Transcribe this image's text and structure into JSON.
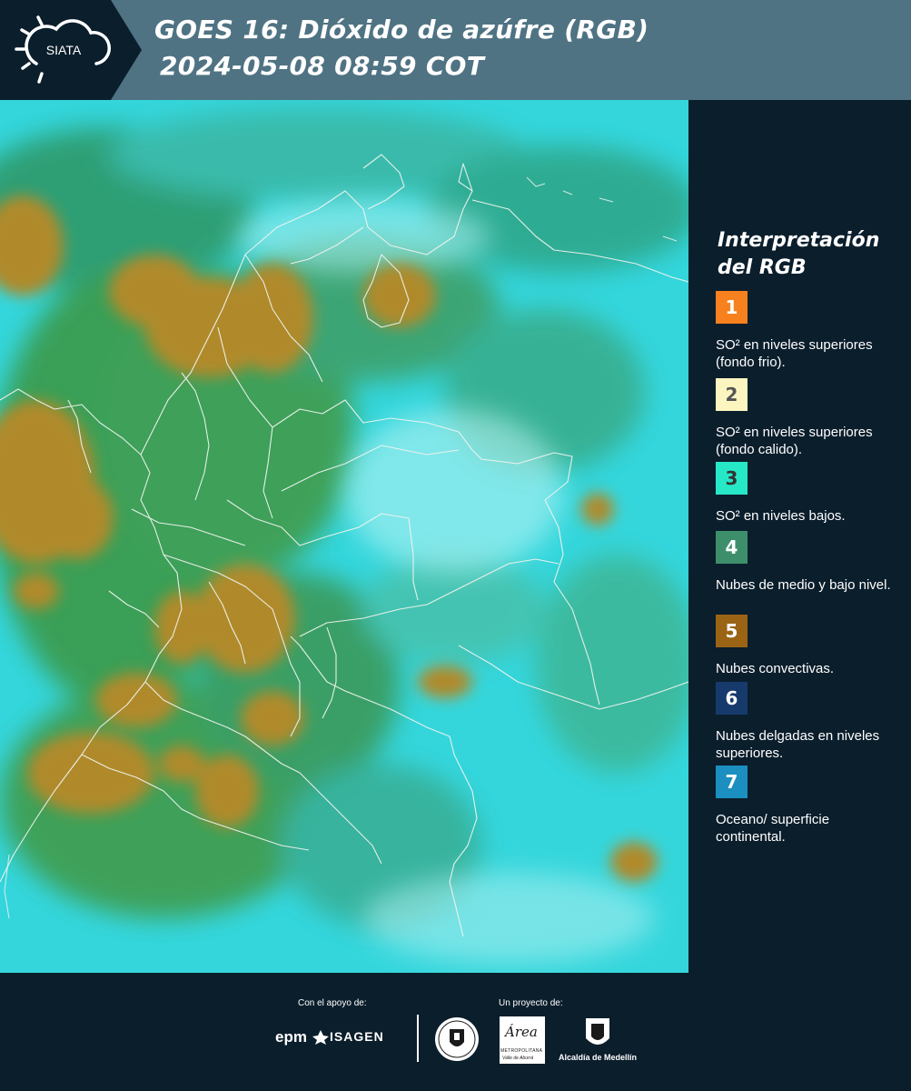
{
  "header": {
    "logo_text": "SIATA",
    "title_line1": "GOES 16: Dióxido de azúfre (RGB)",
    "title_line2": "2024-05-08 08:59 COT"
  },
  "legend": {
    "title": "Interpretación del RGB",
    "items": [
      {
        "number": "1",
        "label": "SO² en niveles superiores (fondo frio).",
        "color": "#f7811e",
        "text_color": "#ffffff"
      },
      {
        "number": "2",
        "label": "SO² en niveles superiores (fondo calido).",
        "color": "#fdf5c0",
        "text_color": "#555555"
      },
      {
        "number": "3",
        "label": "SO² en niveles bajos.",
        "color": "#27e8c6",
        "text_color": "#333333"
      },
      {
        "number": "4",
        "label": "Nubes de medio y bajo nivel.",
        "color": "#3d8f6b",
        "text_color": "#ffffff"
      },
      {
        "number": "5",
        "label": "Nubes convectivas.",
        "color": "#9a6414",
        "text_color": "#ffffff"
      },
      {
        "number": "6",
        "label": "Nubes delgadas en niveles superiores.",
        "color": "#173a6d",
        "text_color": "#ffffff"
      },
      {
        "number": "7",
        "label": "Oceano/ superficie continental.",
        "color": "#1b8fc0",
        "text_color": "#ffffff"
      }
    ]
  },
  "footer": {
    "support_label": "Con el apoyo de:",
    "project_label": "Un proyecto de:",
    "sponsors": [
      "epm",
      "ISAGEN"
    ],
    "partners": [
      "Área",
      "METROPOLITANA",
      "Valle de Aburrá",
      "Alcaldía de Medellín"
    ]
  },
  "colors": {
    "header_bg": "#4f7383",
    "page_bg": "#0b1e2c",
    "map_cyan": "#34d6dc",
    "map_green": "#3f9b4c",
    "map_orange": "#b08a2c"
  }
}
